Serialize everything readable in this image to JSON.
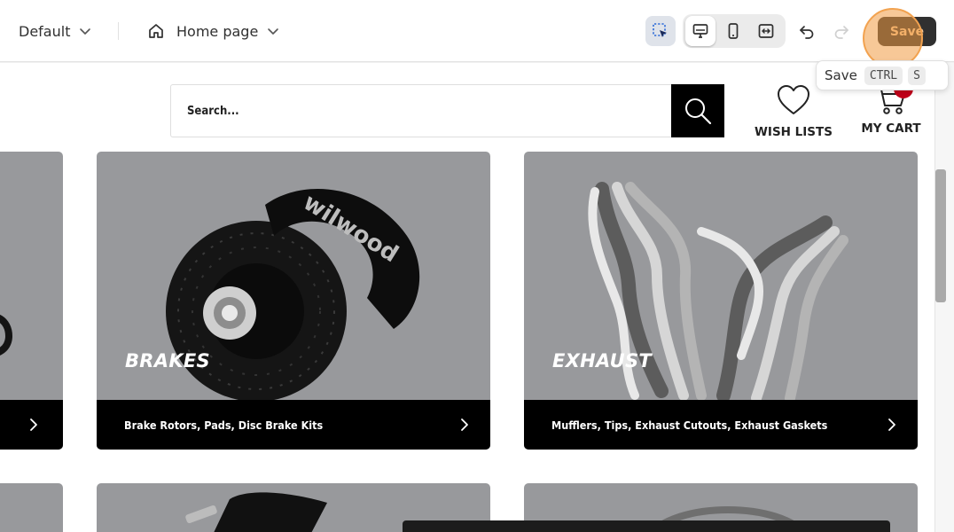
{
  "toolbar": {
    "theme_select": "Default",
    "page_select": "Home page",
    "save_label": "Save"
  },
  "tooltip": {
    "label": "Save",
    "keys": [
      "CTRL",
      "S"
    ]
  },
  "store": {
    "search_placeholder": "Search...",
    "wishlist_label": "WISH LISTS",
    "cart_label": "MY CART",
    "categories": [
      {
        "title": "BRAKES",
        "caption": "Brake Rotors, Pads, Disc Brake Kits"
      },
      {
        "title": "EXHAUST",
        "caption": "Mufflers, Tips, Exhaust Cutouts, Exhaust Gaskets"
      }
    ]
  },
  "colors": {
    "save_bg": "#303030",
    "save_text": "#f6c999",
    "highlight": "#f2a24f",
    "card_bg": "#98999c",
    "badge": "#c0001a"
  },
  "icons": [
    "chevron-down-icon",
    "home-icon",
    "select-element-icon",
    "desktop-icon",
    "mobile-icon",
    "full-width-icon",
    "undo-icon",
    "redo-icon",
    "search-icon",
    "heart-icon",
    "cart-icon",
    "chevron-right-icon"
  ]
}
